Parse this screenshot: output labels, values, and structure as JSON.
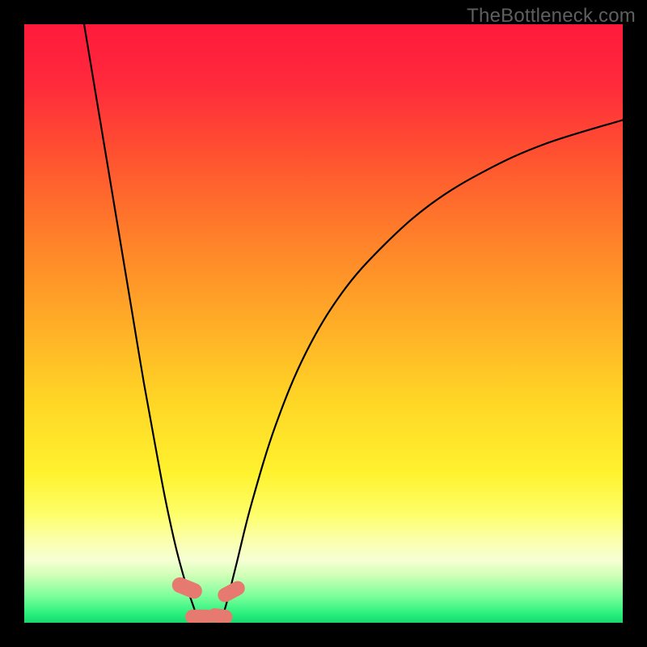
{
  "watermark": "TheBottleneck.com",
  "chart_data": {
    "type": "line",
    "title": "",
    "xlabel": "",
    "ylabel": "",
    "xlim": [
      0,
      100
    ],
    "ylim": [
      0,
      100
    ],
    "background_gradient": {
      "stops": [
        {
          "offset": 0.0,
          "color": "#ff1a3c"
        },
        {
          "offset": 0.1,
          "color": "#ff2a3c"
        },
        {
          "offset": 0.22,
          "color": "#ff5230"
        },
        {
          "offset": 0.35,
          "color": "#ff7e2a"
        },
        {
          "offset": 0.5,
          "color": "#ffad27"
        },
        {
          "offset": 0.63,
          "color": "#ffd626"
        },
        {
          "offset": 0.75,
          "color": "#fff22e"
        },
        {
          "offset": 0.82,
          "color": "#fdff6b"
        },
        {
          "offset": 0.86,
          "color": "#fbffa9"
        },
        {
          "offset": 0.895,
          "color": "#f6ffd4"
        },
        {
          "offset": 0.92,
          "color": "#d2ffb8"
        },
        {
          "offset": 0.955,
          "color": "#7dff9b"
        },
        {
          "offset": 0.985,
          "color": "#29f07d"
        },
        {
          "offset": 1.0,
          "color": "#17d86f"
        }
      ]
    },
    "series": [
      {
        "name": "left_curve",
        "x": [
          10.0,
          12.0,
          14.0,
          16.0,
          18.0,
          20.0,
          22.0,
          23.5,
          25.0,
          26.0,
          27.0,
          28.0,
          28.8
        ],
        "y": [
          100.0,
          88.0,
          76.0,
          64.0,
          52.0,
          40.0,
          29.0,
          21.0,
          14.0,
          10.0,
          6.5,
          3.5,
          1.2
        ]
      },
      {
        "name": "right_curve",
        "x": [
          33.2,
          34.0,
          35.5,
          38.0,
          42.0,
          47.0,
          53.0,
          60.0,
          68.0,
          77.0,
          87.0,
          100.0
        ],
        "y": [
          1.2,
          4.0,
          10.0,
          20.0,
          33.0,
          45.0,
          55.0,
          63.0,
          70.0,
          75.5,
          80.0,
          84.0
        ]
      },
      {
        "name": "bottom_link",
        "x": [
          28.8,
          30.0,
          31.5,
          33.2
        ],
        "y": [
          1.2,
          0.5,
          0.5,
          1.2
        ]
      }
    ],
    "markers": [
      {
        "shape": "capsule",
        "cx": 27.2,
        "cy": 5.8,
        "w": 2.6,
        "h": 5.2,
        "angle": -68,
        "color": "#e77a70"
      },
      {
        "shape": "capsule",
        "cx": 29.3,
        "cy": 1.0,
        "w": 4.8,
        "h": 2.4,
        "angle": 0,
        "color": "#e77a70"
      },
      {
        "shape": "capsule",
        "cx": 32.7,
        "cy": 1.1,
        "w": 4.2,
        "h": 2.4,
        "angle": 8,
        "color": "#e77a70"
      },
      {
        "shape": "capsule",
        "cx": 34.6,
        "cy": 5.2,
        "w": 2.4,
        "h": 4.8,
        "angle": 62,
        "color": "#e77a70"
      }
    ]
  }
}
